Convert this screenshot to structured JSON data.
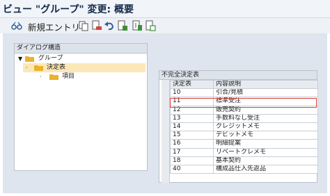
{
  "window": {
    "title": "ビュー \"グループ\" 変更: 概要"
  },
  "toolbar": {
    "new_entries_label": "新規エントリ",
    "icons": [
      "glasses-icon",
      "copy-icon",
      "delete-icon",
      "undo-icon",
      "select-all-icon",
      "select-block-icon",
      "deselect-all-icon"
    ]
  },
  "tree": {
    "header": "ダイアログ構造",
    "nodes": [
      {
        "label": "グループ",
        "level": 0,
        "expanded": true
      },
      {
        "label": "決定表",
        "level": 1,
        "selected": true
      },
      {
        "label": "項目",
        "level": 2
      }
    ]
  },
  "table": {
    "header": "不完全決定表",
    "columns": [
      "決定表",
      "内容説明"
    ],
    "rows": [
      [
        "10",
        "引合/見積"
      ],
      [
        "11",
        "標準受注"
      ],
      [
        "12",
        "販売契約"
      ],
      [
        "13",
        "手数料なし受注"
      ],
      [
        "14",
        "クレジットメモ"
      ],
      [
        "15",
        "デビットメモ"
      ],
      [
        "16",
        "明細提案"
      ],
      [
        "17",
        "リベートクレメモ"
      ],
      [
        "18",
        "基本契約"
      ],
      [
        "40",
        "構成品仕入先返品"
      ]
    ],
    "highlighted_row": "11"
  },
  "colors": {
    "accent": "#12294a",
    "selection": "#fce7b8",
    "highlight_border": "#d9413a",
    "folder": "#e9b22e"
  }
}
